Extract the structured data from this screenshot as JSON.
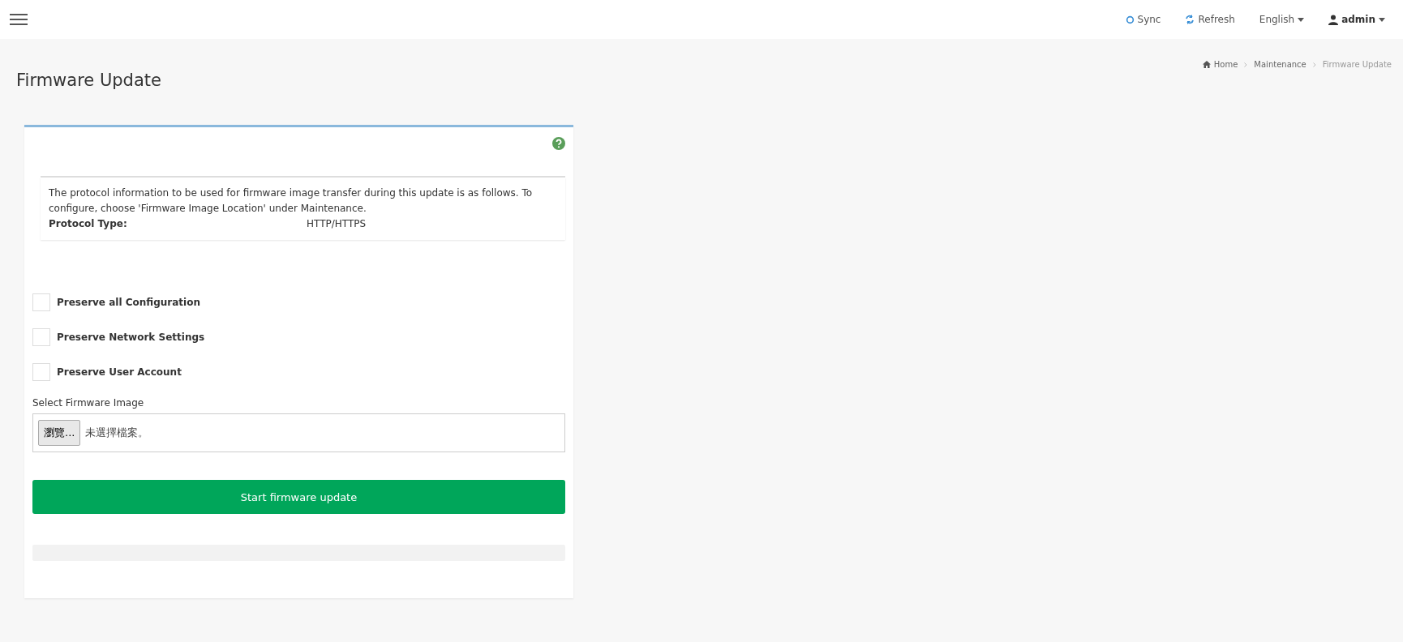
{
  "topbar": {
    "items": [
      {
        "kind": "sync",
        "label": "Sync"
      },
      {
        "kind": "refresh",
        "label": "Refresh"
      },
      {
        "kind": "dropdown",
        "label": "English"
      },
      {
        "kind": "user",
        "label": "admin"
      }
    ]
  },
  "page_title": "Firmware Update",
  "breadcrumb": [
    {
      "label": "Home",
      "kind": "home"
    },
    {
      "label": "Maintenance",
      "kind": "link"
    },
    {
      "label": "Firmware Update",
      "kind": "current"
    }
  ],
  "info": {
    "text": "The protocol information to be used for firmware image transfer during this update is as follows. To configure, choose 'Firmware Image Location' under Maintenance.",
    "protocol_label": "Protocol Type:",
    "protocol_value": "HTTP/HTTPS"
  },
  "options": [
    {
      "label": "Preserve all Configuration",
      "checked": false
    },
    {
      "label": "Preserve Network Settings",
      "checked": false
    },
    {
      "label": "Preserve User Account",
      "checked": false
    }
  ],
  "file_select": {
    "label": "Select Firmware Image",
    "button": "瀏覽...",
    "value": "未選擇檔案。"
  },
  "start_button": "Start firmware update",
  "progress": {
    "level": 0
  }
}
